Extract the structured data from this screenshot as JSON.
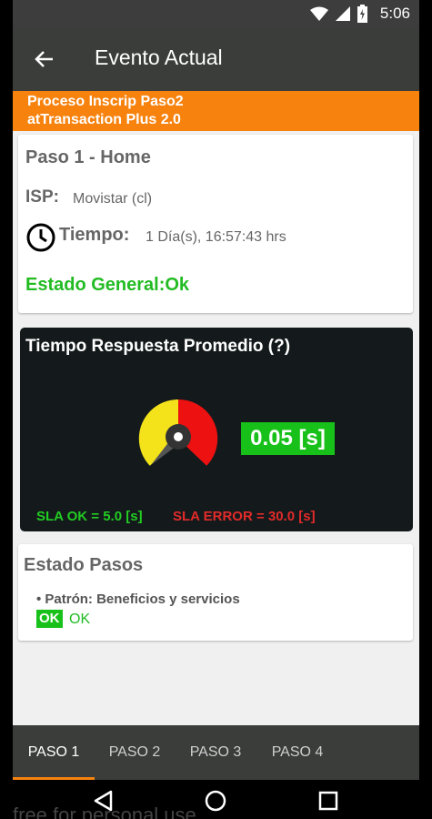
{
  "status": {
    "time": "5:06"
  },
  "appbar": {
    "title": "Evento Actual"
  },
  "banner": {
    "line1": "Proceso Inscrip Paso2",
    "line2": "atTransaction Plus 2.0"
  },
  "summary": {
    "step_title": "Paso 1 - Home",
    "isp_label": "ISP:",
    "isp_value": "Movistar (cl)",
    "time_label": "Tiempo:",
    "time_value": "1 Día(s), 16:57:43 hrs",
    "status": "Estado General:Ok"
  },
  "gauge": {
    "title": "Tiempo Respuesta Promedio (?)",
    "value": "0.05 [s]",
    "sla_ok": "SLA OK = 5.0 [s]",
    "sla_error": "SLA ERROR = 30.0 [s]",
    "colors": {
      "green": "#22cc22",
      "yellow": "#f4e21a",
      "red": "#ee1111"
    }
  },
  "steps": {
    "title": "Estado Pasos",
    "item": "• Patrón: Beneficios y servicios",
    "badge": "OK",
    "status": "OK"
  },
  "tabs": [
    {
      "label": "PASO 1",
      "active": true
    },
    {
      "label": "PASO 2",
      "active": false
    },
    {
      "label": "PASO 3",
      "active": false
    },
    {
      "label": "PASO 4",
      "active": false
    }
  ],
  "watermark": "free for personal use",
  "colors": {
    "accent": "#f7820e",
    "toolbar": "#3a3d3a",
    "ok_green": "#18c11a",
    "error_red": "#e32a2a"
  }
}
